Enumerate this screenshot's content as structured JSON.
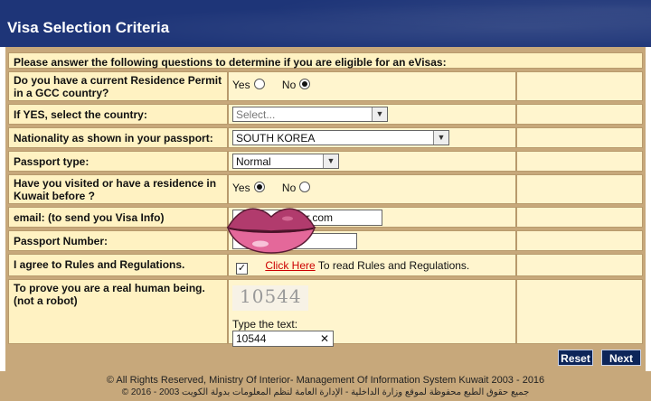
{
  "header": {
    "title": "Visa Selection Criteria"
  },
  "form": {
    "intro": "Please answer the following questions to determine if you are eligible for an eVisas:",
    "q1": {
      "label": "Do you have a current Residence Permit in a GCC country?",
      "yes": "Yes",
      "no": "No",
      "selected": "No"
    },
    "q2": {
      "label": "If YES, select the country:",
      "value": "Select..."
    },
    "q3": {
      "label": "Nationality as shown in your passport:",
      "value": "SOUTH KOREA"
    },
    "q4": {
      "label": "Passport type:",
      "value": "Normal"
    },
    "q5": {
      "label": "Have you visited or have a residence in Kuwait before ?",
      "yes": "Yes",
      "no": "No",
      "selected": "Yes"
    },
    "q6": {
      "label": "email: (to send you Visa Info)",
      "value": "r.com"
    },
    "q7": {
      "label": "Passport Number:",
      "value": ""
    },
    "q8": {
      "label": "I agree to Rules and Regulations.",
      "checked": true,
      "link": "Click Here",
      "link_suffix": "To read Rules and Regulations."
    },
    "q9": {
      "label": "To prove you are a real human being. (not a robot)",
      "captcha": "10544",
      "type_label": "Type the text:",
      "value": "10544"
    }
  },
  "buttons": {
    "reset": "Reset",
    "next": "Next"
  },
  "footer": {
    "line1": "© All Rights Reserved, Ministry Of Interior- Management Of Information System Kuwait 2003 - 2016",
    "line2": "جميع حقوق الطبع محفوظة لموقع وزارة الداخلية - الإدارة العامة لنظم المعلومات بدولة الكويت 2003 - 2016 ©"
  },
  "colors": {
    "header": "#1e3578",
    "frame": "#c7a87b",
    "cell": "#fff5ce",
    "button": "#0d2559",
    "link": "#cc0000"
  }
}
